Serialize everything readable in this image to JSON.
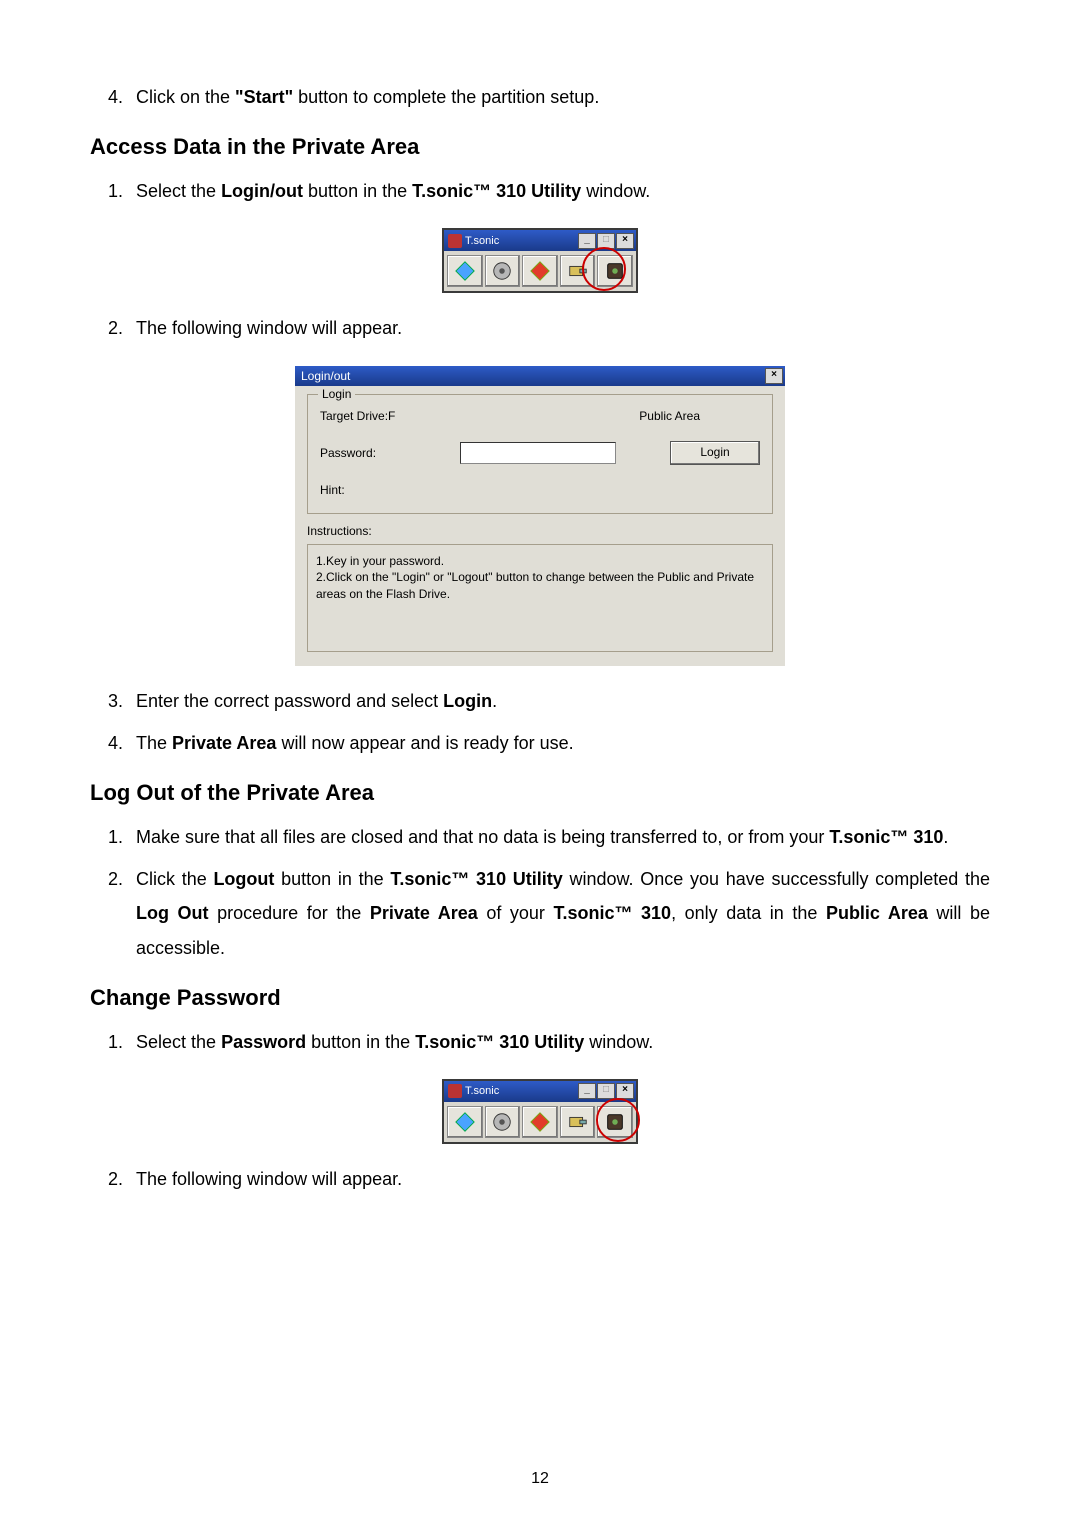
{
  "page_number": "12",
  "step4": {
    "prefix": "Click on the ",
    "bold": "\"Start\"",
    "suffix": " button to complete the partition setup."
  },
  "sectionA": {
    "heading": "Access Data in the Private Area",
    "s1": {
      "a": "Select the ",
      "b": "Login/out",
      "c": " button in the ",
      "d": "T.sonic™ 310 Utility",
      "e": " window."
    },
    "s2": "The following window will appear.",
    "s3": {
      "a": "Enter the correct password and select ",
      "b": "Login",
      "c": "."
    },
    "s4": {
      "a": "The ",
      "b": "Private Area",
      "c": " will now appear and is ready for use."
    }
  },
  "toolbar": {
    "title": "T.sonic",
    "icons": [
      "partition-icon",
      "format-icon",
      "logout-icon",
      "login-icon",
      "password-icon"
    ]
  },
  "login_dialog": {
    "title": "Login/out",
    "group_legend": "Login",
    "target_drive_label": "Target Drive:F",
    "area_label": "Public Area",
    "password_label": "Password:",
    "login_btn": "Login",
    "hint_label": "Hint:",
    "hint_value": "",
    "instructions_label": "Instructions:",
    "instr_line1": "1.Key in your password.",
    "instr_line2": "2.Click on the \"Login\" or \"Logout\" button to change between the Public and Private areas on the Flash Drive."
  },
  "sectionB": {
    "heading": "Log Out of the Private Area",
    "s1": {
      "a": "Make sure that all files are closed and that no data is being transferred to, or from your ",
      "b": "T.sonic™ 310",
      "c": "."
    },
    "s2": {
      "a": "Click the ",
      "b": "Logout",
      "c": " button in the ",
      "d": "T.sonic™ 310 Utility",
      "e": " window. Once you have successfully completed the ",
      "f": "Log Out",
      "g": " procedure for the ",
      "h": "Private Area",
      "i": " of your ",
      "j": "T.sonic™ 310",
      "k": ", only data in the ",
      "l": "Public Area",
      "m": " will be accessible."
    }
  },
  "sectionC": {
    "heading": "Change Password",
    "s1": {
      "a": "Select the ",
      "b": "Password",
      "c": " button in the ",
      "d": "T.sonic™ 310 Utility",
      "e": " window."
    },
    "s2": "The following window will appear."
  }
}
